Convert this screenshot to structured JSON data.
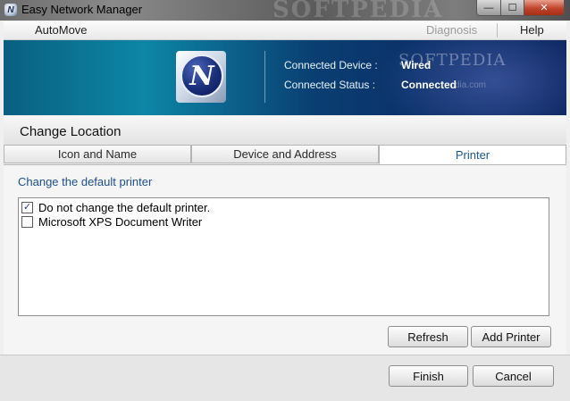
{
  "window": {
    "title": "Easy Network Manager",
    "app_icon_letter": "N",
    "watermark": "SOFTPEDIA",
    "controls": {
      "minimize": "—",
      "maximize": "☐",
      "close": "✕"
    }
  },
  "menubar": {
    "automove": "AutoMove",
    "diagnosis": "Diagnosis",
    "help": "Help"
  },
  "banner": {
    "logo_letter": "N",
    "device_label": "Connected Device :",
    "device_value": "Wired",
    "status_label": "Connected Status :",
    "status_value": "Connected",
    "watermark": "SOFTPEDIA",
    "watermark_sub": "dia.com"
  },
  "section": {
    "title": "Change Location"
  },
  "tabs": [
    {
      "label": "Icon and Name",
      "selected": false
    },
    {
      "label": "Device and Address",
      "selected": false
    },
    {
      "label": "Printer",
      "selected": true
    }
  ],
  "printer_panel": {
    "heading": "Change the default printer",
    "items": [
      {
        "label": "Do not change the default printer.",
        "checked": true,
        "check_glyph": "✓"
      },
      {
        "label": "Microsoft XPS Document Writer",
        "checked": false,
        "check_glyph": ""
      }
    ],
    "refresh_label": "Refresh",
    "add_printer_label": "Add Printer"
  },
  "footer": {
    "finish_label": "Finish",
    "cancel_label": "Cancel"
  },
  "colors": {
    "banner_start": "#0a5f80",
    "banner_end": "#06225a",
    "selected_tab_text": "#1d5a86",
    "heading_text": "#1d4f8c",
    "close_button": "#c0432a"
  }
}
